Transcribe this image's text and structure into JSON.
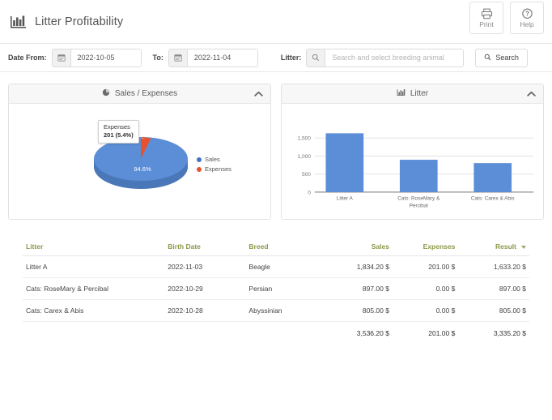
{
  "header": {
    "title": "Litter Profitability",
    "logo_icon": "bar-chart-icon",
    "actions": [
      {
        "label": "Print",
        "icon": "printer-icon"
      },
      {
        "label": "Help",
        "icon": "question-circle-icon"
      }
    ]
  },
  "filters": {
    "date_from_label": "Date From:",
    "date_from_value": "2022-10-05",
    "to_label": "To:",
    "to_value": "2022-11-04",
    "litter_label": "Litter:",
    "litter_placeholder": "Search and select breeding animal",
    "litter_value": "",
    "calendar_icon": "calendar-icon",
    "search_icon": "search-icon",
    "search_button_label": "Search"
  },
  "panels": {
    "pie": {
      "title": "Sales / Expenses",
      "icon": "pie-chart-icon",
      "collapse_icon": "chevron-up-icon"
    },
    "bar": {
      "title": "Litter",
      "icon": "bar-chart-icon",
      "collapse_icon": "chevron-up-icon"
    }
  },
  "pie_tooltip": {
    "name": "Expenses",
    "value": "201 (5.4%)"
  },
  "table": {
    "columns": [
      "Litter",
      "Birth Date",
      "Breed",
      "Sales",
      "Expenses",
      "Result"
    ],
    "sorted_column": "Result",
    "sort_direction": "desc",
    "rows": [
      {
        "litter": "Litter A",
        "birth_date": "2022-11-03",
        "breed": "Beagle",
        "sales": "1,834.20 $",
        "expenses": "201.00 $",
        "result": "1,633.20 $"
      },
      {
        "litter": "Cats: RoseMary & Percibal",
        "birth_date": "2022-10-29",
        "breed": "Persian",
        "sales": "897.00 $",
        "expenses": "0.00 $",
        "result": "897.00 $"
      },
      {
        "litter": "Cats: Carex & Abis",
        "birth_date": "2022-10-28",
        "breed": "Abyssinian",
        "sales": "805.00 $",
        "expenses": "0.00 $",
        "result": "805.00 $"
      }
    ],
    "totals": {
      "litter": "",
      "birth_date": "",
      "breed": "",
      "sales": "3,536.20 $",
      "expenses": "201.00 $",
      "result": "3,335.20 $"
    }
  },
  "colors": {
    "series_sales": "#5b8ed6",
    "series_expenses": "#e8512f",
    "series_sales_dark": "#4a77b8",
    "table_header": "#8a9a4a",
    "link": "#7a9a3c"
  },
  "chart_data": [
    {
      "type": "pie",
      "title": "Sales / Expenses",
      "labels": [
        "Sales",
        "Expenses"
      ],
      "values": [
        3536.2,
        201.0
      ],
      "percent_labels": [
        "94.6%",
        "5.4%"
      ],
      "colors": [
        "#5b8ed6",
        "#e8512f"
      ],
      "legend": [
        "Sales",
        "Expenses"
      ],
      "legend_position": "right",
      "annotations": [
        "Expenses 201 (5.4%)"
      ],
      "three_d": true
    },
    {
      "type": "bar",
      "title": "Litter",
      "categories": [
        "Litter A",
        "Cats: RoseMary & Percibal",
        "Cats: Carex & Abis"
      ],
      "values": [
        1633.2,
        897.0,
        805.0
      ],
      "ytick_labels": [
        "0",
        "500",
        "1,000",
        "1,500"
      ],
      "yticks": [
        0,
        500,
        1000,
        1500
      ],
      "ylim": [
        0,
        1750
      ],
      "xlabel": "",
      "ylabel": "",
      "grid": true,
      "legend_position": "none",
      "bar_color": "#5b8ed6"
    }
  ]
}
